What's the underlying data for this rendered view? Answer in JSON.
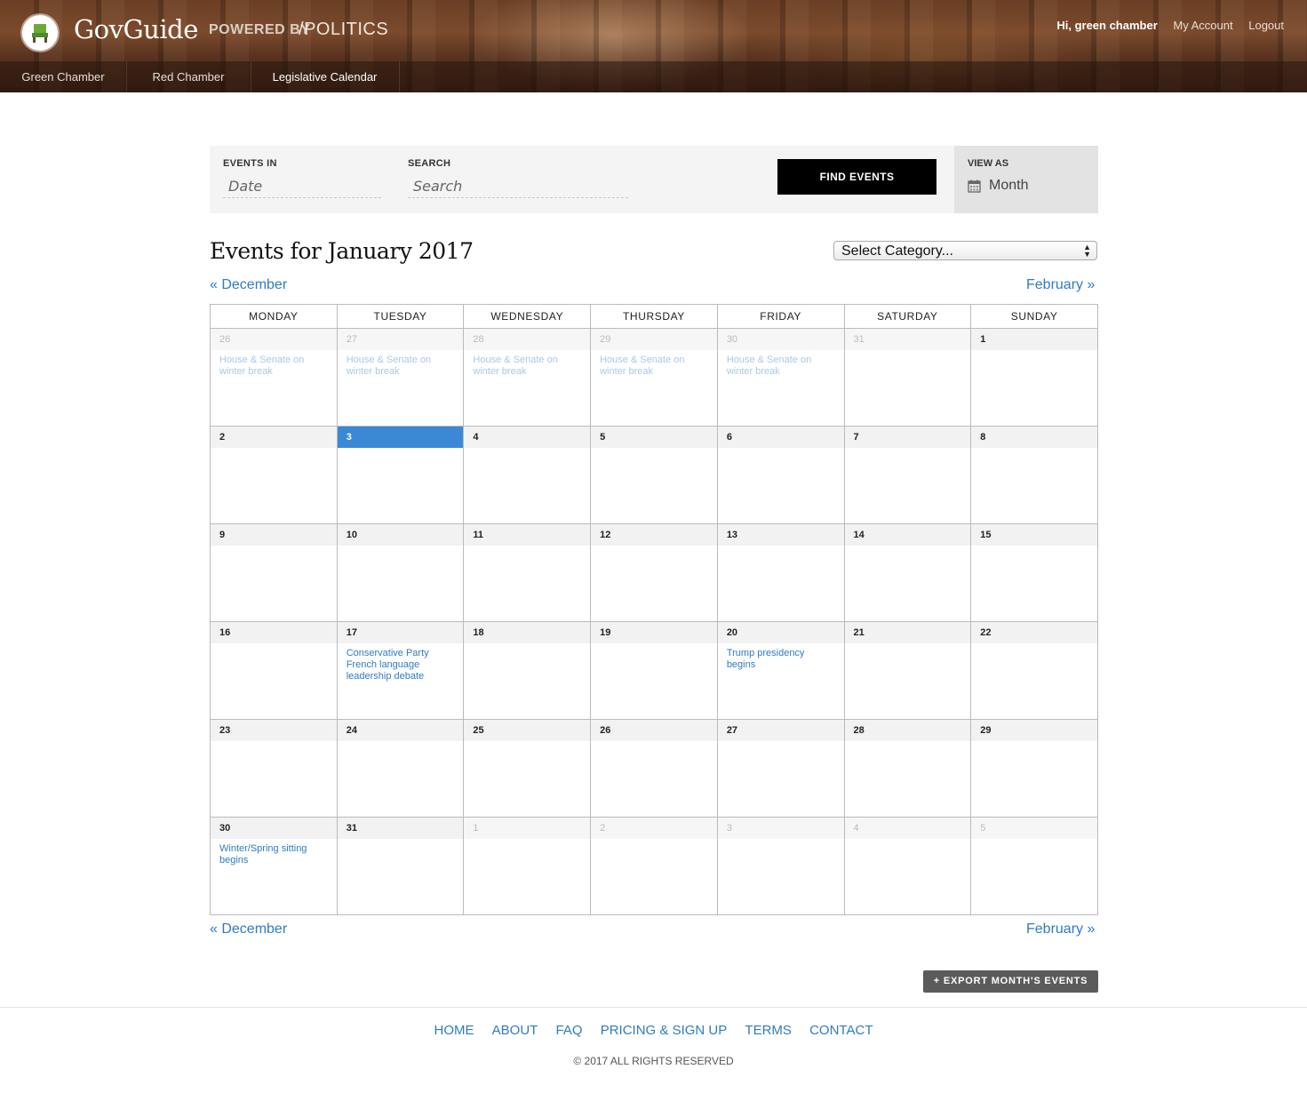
{
  "header": {
    "brand": "GovGuide",
    "powered_by": "POWERED BY",
    "partner": "POLITICS",
    "greeting": "Hi, green chamber",
    "my_account": "My Account",
    "logout": "Logout"
  },
  "nav": [
    {
      "label": "Green Chamber"
    },
    {
      "label": "Red Chamber"
    },
    {
      "label": "Legislative Calendar"
    }
  ],
  "filters": {
    "events_in_label": "EVENTS IN",
    "date_placeholder": "Date",
    "search_label": "SEARCH",
    "search_placeholder": "Search",
    "find_button": "FIND EVENTS",
    "view_as_label": "VIEW AS",
    "view_as_value": "Month"
  },
  "title": "Events for January 2017",
  "category_select": "Select Category...",
  "prev_month": "« December",
  "next_month": "February »",
  "calendar": {
    "weekdays": [
      "MONDAY",
      "TUESDAY",
      "WEDNESDAY",
      "THURSDAY",
      "FRIDAY",
      "SATURDAY",
      "SUNDAY"
    ],
    "weeks": [
      [
        {
          "day": "26",
          "other": true,
          "event": "House & Senate on winter break"
        },
        {
          "day": "27",
          "other": true,
          "event": "House & Senate on winter break"
        },
        {
          "day": "28",
          "other": true,
          "event": "House & Senate on winter break"
        },
        {
          "day": "29",
          "other": true,
          "event": "House & Senate on winter break"
        },
        {
          "day": "30",
          "other": true,
          "event": "House & Senate on winter break"
        },
        {
          "day": "31",
          "other": true,
          "event": ""
        },
        {
          "day": "1",
          "other": false,
          "event": ""
        }
      ],
      [
        {
          "day": "2",
          "other": false,
          "event": ""
        },
        {
          "day": "3",
          "other": false,
          "today": true,
          "event": ""
        },
        {
          "day": "4",
          "other": false,
          "event": ""
        },
        {
          "day": "5",
          "other": false,
          "event": ""
        },
        {
          "day": "6",
          "other": false,
          "event": ""
        },
        {
          "day": "7",
          "other": false,
          "event": ""
        },
        {
          "day": "8",
          "other": false,
          "event": ""
        }
      ],
      [
        {
          "day": "9",
          "other": false,
          "event": ""
        },
        {
          "day": "10",
          "other": false,
          "event": ""
        },
        {
          "day": "11",
          "other": false,
          "event": ""
        },
        {
          "day": "12",
          "other": false,
          "event": ""
        },
        {
          "day": "13",
          "other": false,
          "event": ""
        },
        {
          "day": "14",
          "other": false,
          "event": ""
        },
        {
          "day": "15",
          "other": false,
          "event": ""
        }
      ],
      [
        {
          "day": "16",
          "other": false,
          "event": ""
        },
        {
          "day": "17",
          "other": false,
          "event": "Conservative Party French language leadership debate"
        },
        {
          "day": "18",
          "other": false,
          "event": ""
        },
        {
          "day": "19",
          "other": false,
          "event": ""
        },
        {
          "day": "20",
          "other": false,
          "event": "Trump presidency begins"
        },
        {
          "day": "21",
          "other": false,
          "event": ""
        },
        {
          "day": "22",
          "other": false,
          "event": ""
        }
      ],
      [
        {
          "day": "23",
          "other": false,
          "event": ""
        },
        {
          "day": "24",
          "other": false,
          "event": ""
        },
        {
          "day": "25",
          "other": false,
          "event": ""
        },
        {
          "day": "26",
          "other": false,
          "event": ""
        },
        {
          "day": "27",
          "other": false,
          "event": ""
        },
        {
          "day": "28",
          "other": false,
          "event": ""
        },
        {
          "day": "29",
          "other": false,
          "event": ""
        }
      ],
      [
        {
          "day": "30",
          "other": false,
          "event": "Winter/Spring sitting begins"
        },
        {
          "day": "31",
          "other": false,
          "event": ""
        },
        {
          "day": "1",
          "other": true,
          "event": ""
        },
        {
          "day": "2",
          "other": true,
          "event": ""
        },
        {
          "day": "3",
          "other": true,
          "event": ""
        },
        {
          "day": "4",
          "other": true,
          "event": ""
        },
        {
          "day": "5",
          "other": true,
          "event": ""
        }
      ]
    ]
  },
  "export_button": "+ EXPORT MONTH'S EVENTS",
  "footer": {
    "links": [
      "HOME",
      "ABOUT",
      "FAQ",
      "PRICING & SIGN UP",
      "TERMS",
      "CONTACT"
    ],
    "copyright": "© 2017 ALL RIGHTS RESERVED"
  },
  "colors": {
    "link": "#2f7bc2",
    "today": "#3b88d6",
    "button_dark": "#000000"
  }
}
